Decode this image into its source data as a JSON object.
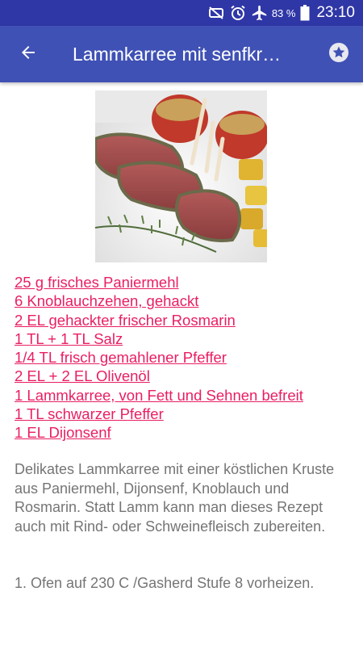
{
  "status_bar": {
    "icons": [
      "mute-icon",
      "alarm-icon",
      "airplane-mode-icon",
      "battery-icon"
    ],
    "battery_percent": "83 %",
    "time": "23:10"
  },
  "app_bar": {
    "title": "Lammkarree mit senfkr…",
    "back_icon": "arrow-back-icon",
    "favorite_icon": "star-icon",
    "color": "#3f51b5",
    "status_color": "#2f37a6"
  },
  "recipe": {
    "image": "lamb-rack-photo",
    "ingredients": [
      "25 g frisches Paniermehl",
      "6 Knoblauchzehen, gehackt",
      "2 EL gehackter frischer Rosmarin",
      "1 TL + 1 TL Salz",
      "1/4 TL frisch gemahlener Pfeffer",
      "2 EL + 2 EL Olivenöl",
      "1 Lammkarree, von Fett und Sehnen befreit",
      "1 TL schwarzer Pfeffer",
      "1 EL Dijonsenf"
    ],
    "ingredient_color": "#e91e63",
    "description": "Delikates Lammkarree mit einer köstlichen Kruste aus Paniermehl, Dijonsenf, Knoblauch und Rosmarin. Statt Lamm kann man dieses Rezept auch mit Rind- oder Schweinefleisch zubereiten.",
    "steps": [
      "1. Ofen auf 230 C /Gasherd Stufe 8 vorheizen."
    ]
  }
}
